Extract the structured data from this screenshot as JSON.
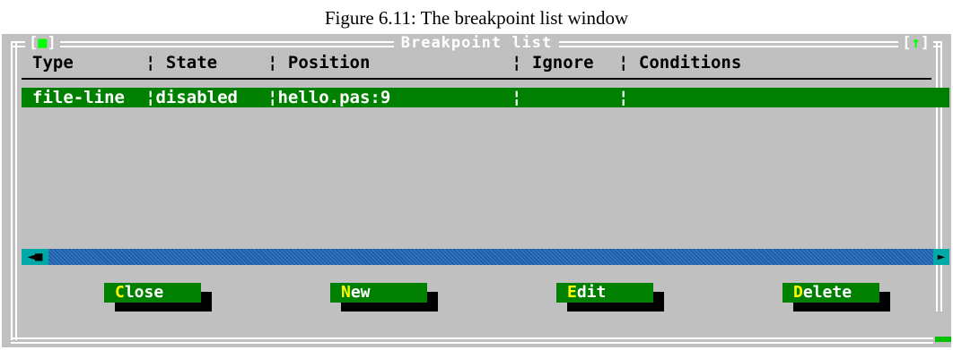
{
  "figure_caption": "Figure 6.11: The breakpoint list window",
  "window": {
    "title": "Breakpoint list",
    "close_box": {
      "left": "[",
      "mark": "■",
      "right": "]"
    },
    "zoom_box": {
      "left": "[",
      "mark": "↑",
      "right": "]"
    }
  },
  "columns": [
    {
      "label": "Type"
    },
    {
      "label": "¦ State"
    },
    {
      "label": "¦ Position"
    },
    {
      "label": "¦ Ignore"
    },
    {
      "label": "¦ Conditions"
    }
  ],
  "rows": [
    {
      "type": "file-line",
      "state": "¦disabled",
      "position": "¦hello.pas:9",
      "ignore": "¦",
      "conditions": "¦",
      "selected": true
    }
  ],
  "scrollbar": {
    "left_arrow": "◄■",
    "right_arrow": "►"
  },
  "buttons": [
    {
      "hot": "C",
      "rest": "lose"
    },
    {
      "hot": "N",
      "rest": "ew"
    },
    {
      "hot": "E",
      "rest": "dit"
    },
    {
      "hot": "D",
      "rest": "elete"
    }
  ],
  "colors": {
    "window_bg": "#c0c0c0",
    "selected_row": "#008000",
    "button_face": "#008000",
    "hotkey": "#ffff00",
    "scrollbar": "#1c5fa8"
  }
}
